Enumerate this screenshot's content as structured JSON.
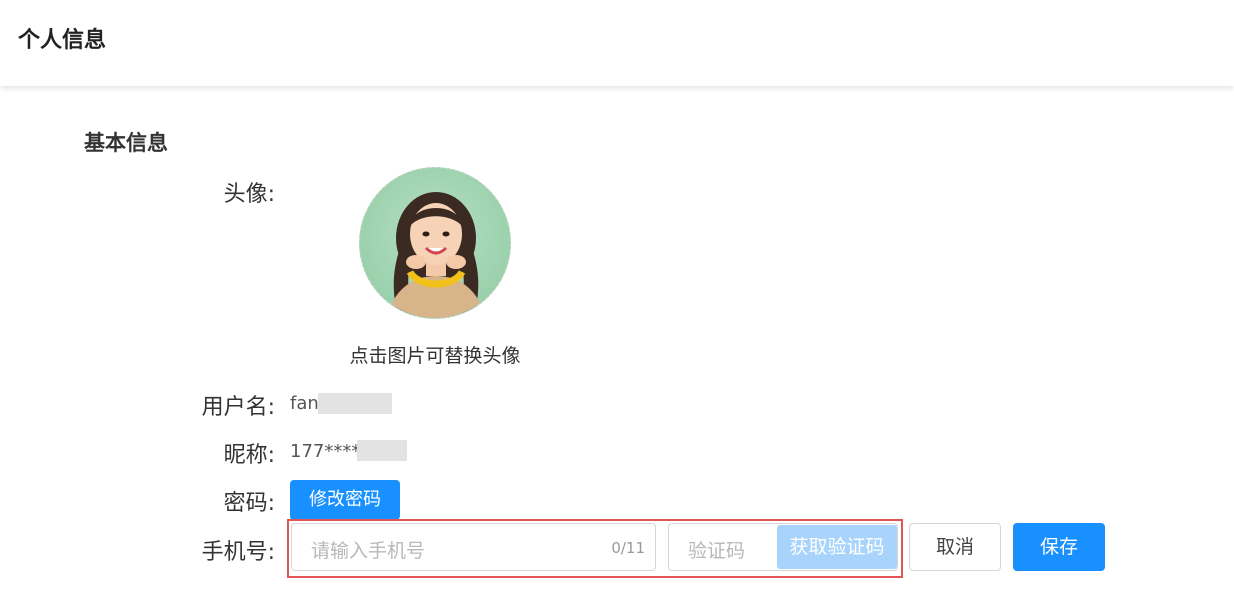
{
  "header": {
    "title": "个人信息"
  },
  "section": {
    "title": "基本信息"
  },
  "avatar": {
    "label": "头像:",
    "hint": "点击图片可替换头像",
    "icon": "user-photo"
  },
  "username": {
    "label": "用户名:",
    "value": "fan"
  },
  "nickname": {
    "label": "昵称:",
    "value": "177****"
  },
  "password": {
    "label": "密码:",
    "button": "修改密码"
  },
  "phone": {
    "label": "手机号:",
    "placeholder": "请输入手机号",
    "counter": "0/11",
    "code_placeholder": "验证码",
    "get_code": "获取验证码",
    "cancel": "取消",
    "save": "保存"
  },
  "colors": {
    "primary": "#1890ff",
    "disabled_primary": "#a8d4fb",
    "error_border": "#e25555"
  }
}
